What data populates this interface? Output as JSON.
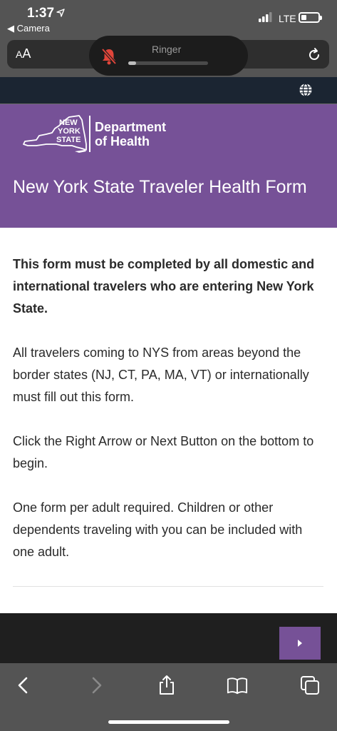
{
  "status_bar": {
    "time": "1:37",
    "back_app": "Camera",
    "network": "LTE",
    "battery_level": 0.3
  },
  "browser": {
    "text_size_label_small": "A",
    "text_size_label_large": "A"
  },
  "ringer": {
    "label": "Ringer",
    "level": 0.1
  },
  "banner": {
    "logo_lines": [
      "NEW",
      "YORK",
      "STATE"
    ],
    "department_line1": "Department",
    "department_line2": "of Health",
    "title": "New York State Traveler Health Form"
  },
  "content": {
    "intro_bold": "This form must be completed by all domestic and international travelers who are entering New York State.",
    "paragraph1": "All travelers coming to NYS from areas beyond the border states (NJ, CT, PA, MA, VT) or internationally must fill out this form.",
    "paragraph2": "Click the Right Arrow or Next Button on the bottom to begin.",
    "paragraph3": "One form per adult required. Children or other dependents traveling with you can be included with one adult."
  },
  "colors": {
    "brand_purple": "#765197",
    "header_navy": "#1b2532",
    "footer_dark": "#1f1f1f",
    "ringer_muted_red": "#e0453a"
  },
  "icons": {
    "location": "location-arrow-icon",
    "globe": "globe-icon",
    "reload": "reload-icon",
    "bell_muted": "bell-slash-icon",
    "next": "play-right-icon",
    "back": "chevron-left-icon",
    "forward": "chevron-right-icon",
    "share": "share-icon",
    "bookmarks": "book-icon",
    "tabs": "tabs-icon"
  }
}
